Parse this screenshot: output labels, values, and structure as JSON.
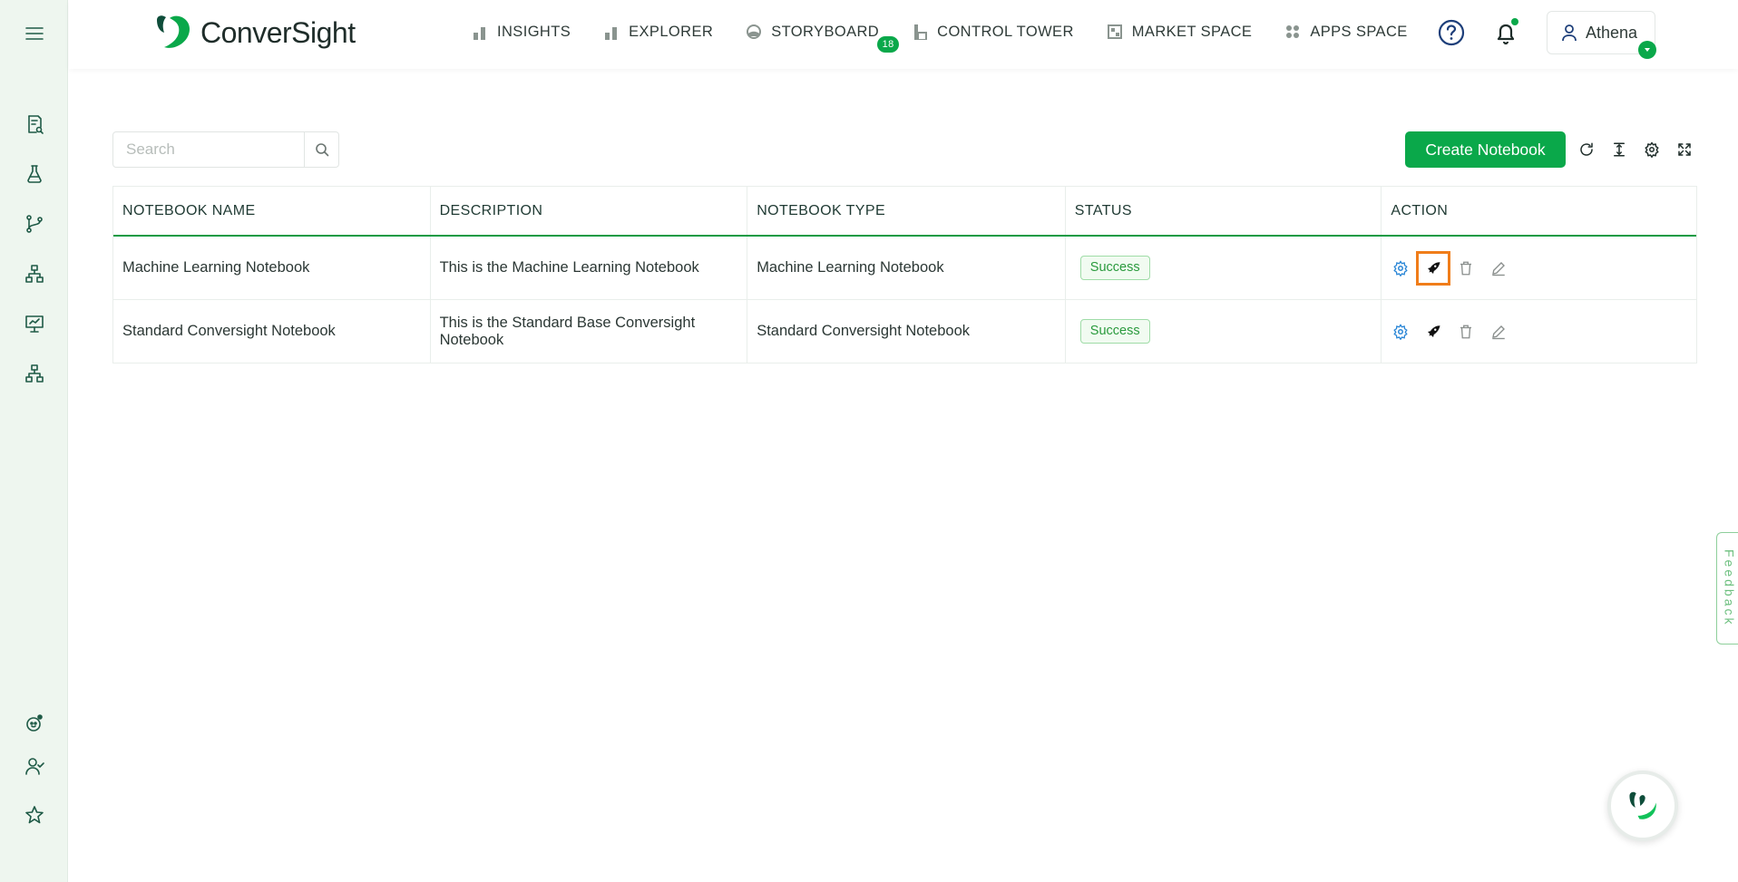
{
  "brand": {
    "name": "ConverSight"
  },
  "nav": {
    "items": [
      {
        "label": "INSIGHTS",
        "icon": "bar-chart-icon"
      },
      {
        "label": "EXPLORER",
        "icon": "bar-chart-icon"
      },
      {
        "label": "STORYBOARD",
        "icon": "globe-icon",
        "badge": "18"
      },
      {
        "label": "CONTROL TOWER",
        "icon": "tower-icon"
      },
      {
        "label": "MARKET SPACE",
        "icon": "store-icon"
      },
      {
        "label": "APPS SPACE",
        "icon": "apps-grid-icon"
      }
    ]
  },
  "user": {
    "name": "Athena"
  },
  "search": {
    "placeholder": "Search"
  },
  "toolbar": {
    "create_label": "Create Notebook"
  },
  "table": {
    "columns": [
      "NOTEBOOK NAME",
      "DESCRIPTION",
      "NOTEBOOK TYPE",
      "STATUS",
      "ACTION"
    ],
    "rows": [
      {
        "name": "Machine Learning Notebook",
        "description": "This is the Machine Learning Notebook",
        "type": "Machine Learning Notebook",
        "status": "Success"
      },
      {
        "name": "Standard Conversight Notebook",
        "description": "This is the Standard Base Conversight Notebook",
        "type": "Standard Conversight Notebook",
        "status": "Success"
      }
    ]
  },
  "feedback": {
    "label": "Feedback"
  },
  "colors": {
    "accent": "#0aa84a",
    "highlight": "#f07d1a",
    "sidebar_bg": "#eef6ef"
  }
}
